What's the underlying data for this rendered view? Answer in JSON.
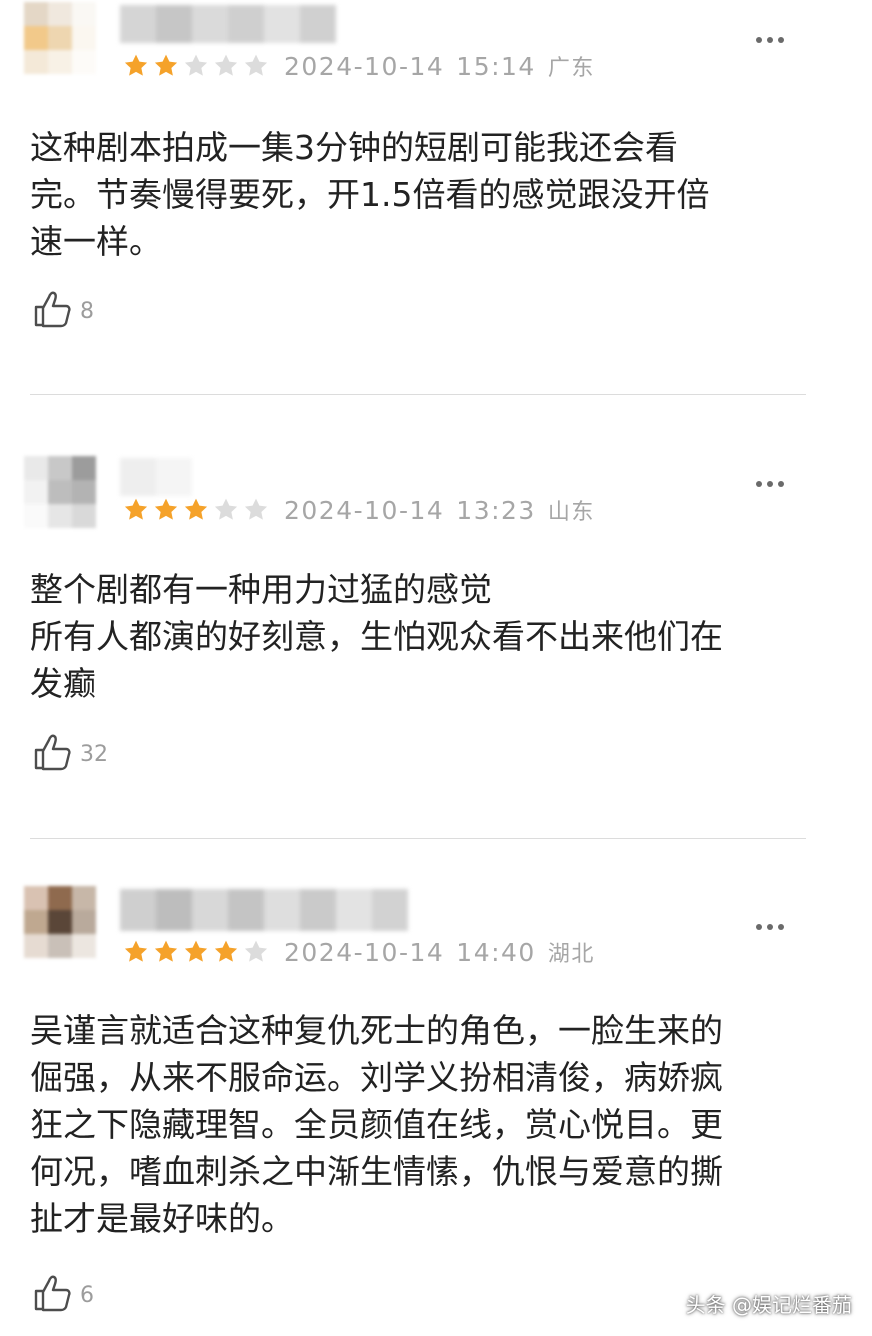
{
  "reviews": [
    {
      "rating": 2,
      "max_rating": 5,
      "date": "2024-10-14",
      "time": "15:14",
      "region": "广东",
      "content": [
        "这种剧本拍成一集3分钟的短剧可能我还会看",
        "完。节奏慢得要死，开1.5倍看的感觉跟没开倍",
        "速一样。"
      ],
      "likes": "8",
      "avatar_colors": [
        "#e4d7c6",
        "#f0e8de",
        "#faf8f4",
        "#f2c98a",
        "#eed6b0",
        "#fbf7f0",
        "#f4e9d8",
        "#f8f1e6",
        "#fdfbf8"
      ],
      "name_colors": [
        "#d5d5d5",
        "#c6c6c6",
        "#dadada",
        "#cfcfcf",
        "#e2e2e2",
        "#d0d0d0"
      ]
    },
    {
      "rating": 3,
      "max_rating": 5,
      "date": "2024-10-14",
      "time": "13:23",
      "region": "山东",
      "content": [
        "整个剧都有一种用力过猛的感觉",
        "所有人都演的好刻意，生怕观众看不出来他们在",
        "发癫"
      ],
      "likes": "32",
      "avatar_colors": [
        "#e9e9e9",
        "#c8c8c8",
        "#9c9c9c",
        "#f2f2f2",
        "#bdbdbd",
        "#b3b3b3",
        "#fafafa",
        "#e6e6e6",
        "#d9d9d9"
      ],
      "name_colors": [
        "#eeeeee",
        "#f5f5f5"
      ]
    },
    {
      "rating": 4,
      "max_rating": 5,
      "date": "2024-10-14",
      "time": "14:40",
      "region": "湖北",
      "content": [
        "吴谨言就适合这种复仇死士的角色，一脸生来的",
        "倔强，从来不服命运。刘学义扮相清俊，病娇疯",
        "狂之下隐藏理智。全员颜值在线，赏心悦目。更",
        "何况，嗜血刺杀之中渐生情愫，仇恨与爱意的撕",
        "扯才是最好味的。"
      ],
      "likes": "6",
      "avatar_colors": [
        "#d9c2b2",
        "#8f6a4e",
        "#c7b7a8",
        "#bfa890",
        "#5a4638",
        "#b9aa9c",
        "#e6dbd2",
        "#c9c0b8",
        "#ece6e0"
      ],
      "name_colors": [
        "#cfcfcf",
        "#bdbdbd",
        "#d8d8d8",
        "#c4c4c4",
        "#dedede",
        "#cacaca",
        "#e3e3e3",
        "#d2d2d2"
      ]
    }
  ],
  "watermark": "头条 @娱记烂番茄",
  "colors": {
    "star_filled": "#f5a22a",
    "star_empty": "#dcdcdc",
    "meta_text": "#a6a6a6",
    "divider": "#dcdcdc"
  },
  "icons": {
    "like": "thumbs-up-icon",
    "more": "more-dots-icon",
    "star": "star-icon"
  }
}
